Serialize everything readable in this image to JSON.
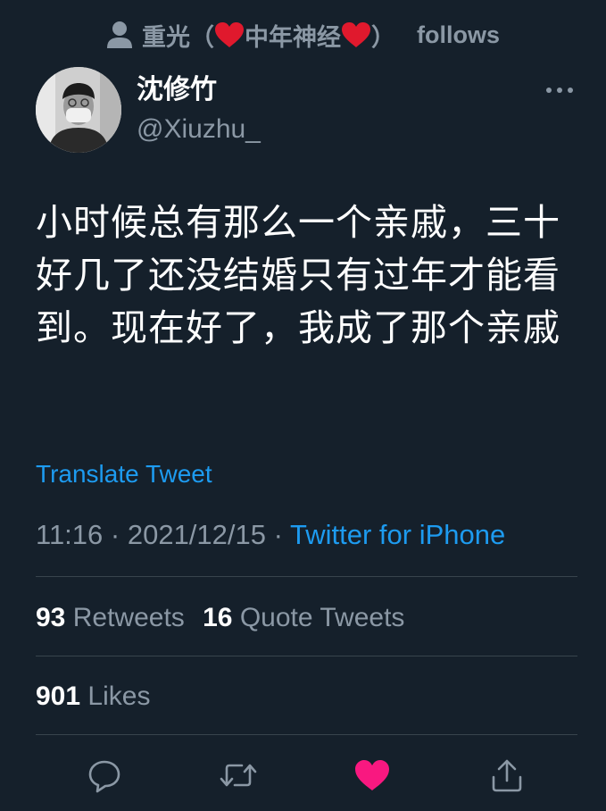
{
  "social_context": {
    "name_prefix": "重光（",
    "name_middle": "中年神经",
    "name_suffix": "）",
    "action": "follows",
    "icon": "person-icon"
  },
  "author": {
    "name": "沈修竹",
    "handle": "@Xiuzhu_"
  },
  "tweet": {
    "text": "小时候总有那么一个亲戚，三十好几了还没结婚只有过年才能看到。现在好了，我成了那个亲戚",
    "translate_label": "Translate Tweet",
    "time": "11:16",
    "date": "2021/12/15",
    "source": "Twitter for iPhone",
    "separator": " · "
  },
  "stats": {
    "retweets_count": "93",
    "retweets_label": "Retweets",
    "quote_count": "16",
    "quote_label": "Quote Tweets",
    "likes_count": "901",
    "likes_label": "Likes"
  },
  "actions": {
    "reply_icon": "reply-icon",
    "retweet_icon": "retweet-icon",
    "like_icon": "heart-icon",
    "share_icon": "share-icon"
  },
  "colors": {
    "background": "#15202b",
    "accent": "#1d9bf0",
    "secondary_text": "#8b98a5",
    "like": "#f91880",
    "heart_emoji": "#e0192d"
  }
}
